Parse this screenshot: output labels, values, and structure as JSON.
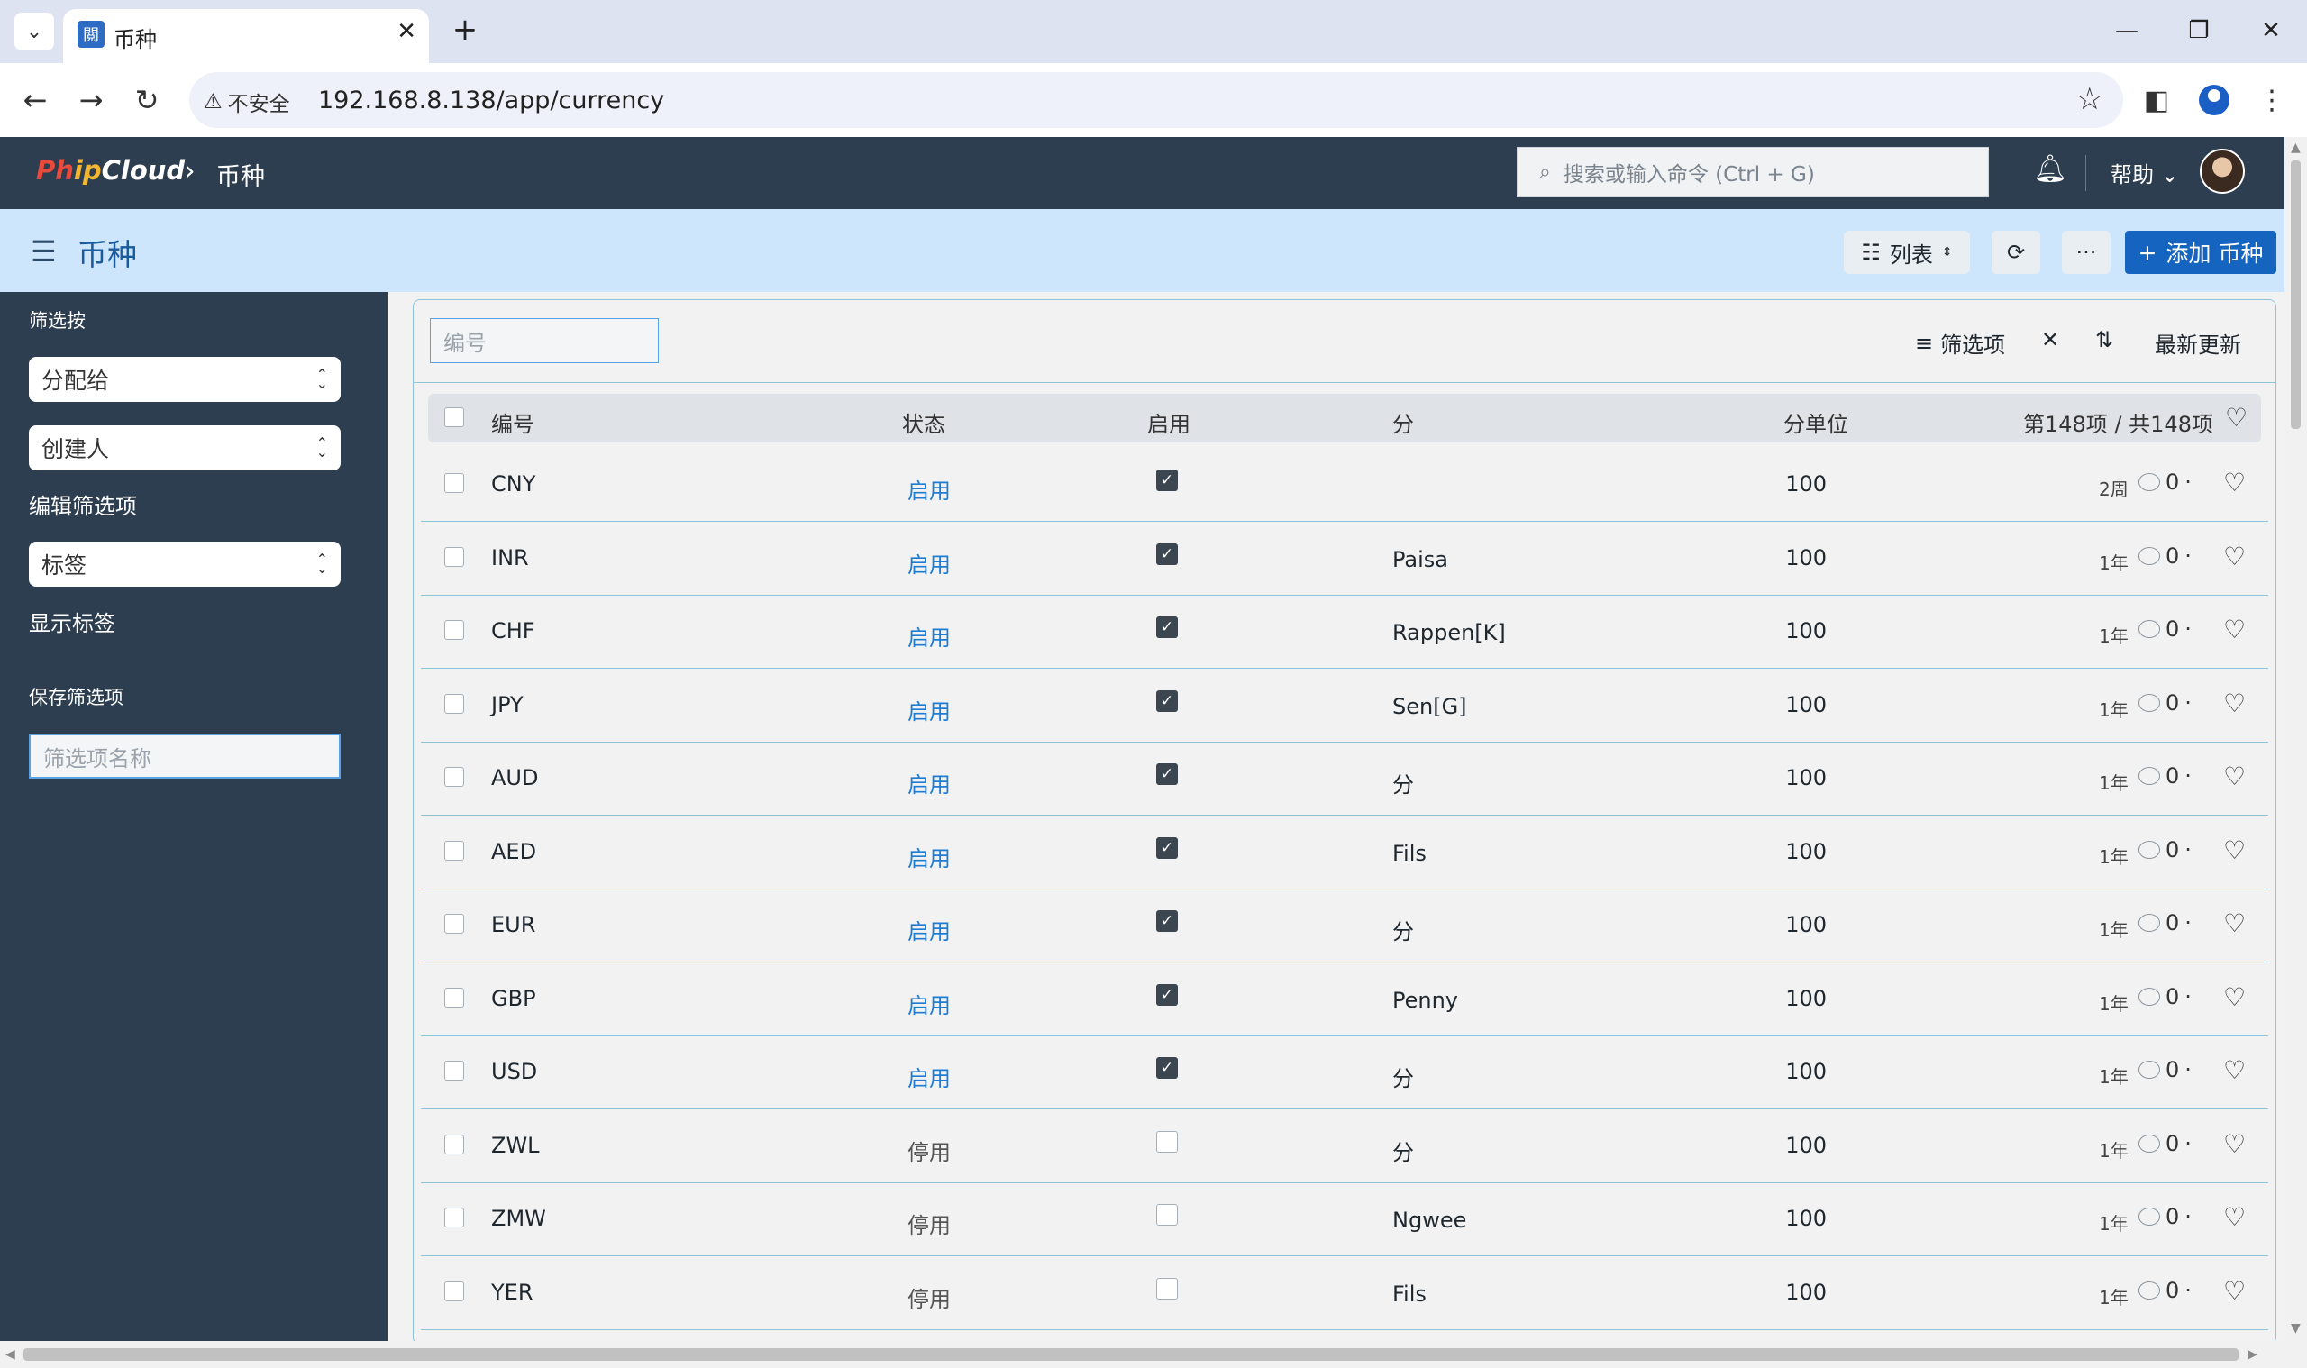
{
  "browser": {
    "tab_title": "币种",
    "favicon": "閲",
    "security_label": "不安全",
    "url": "192.168.8.138/app/currency"
  },
  "navbar": {
    "brand_part1": "Ph",
    "brand_part2": "ip",
    "brand_part3": "Cloud",
    "breadcrumb": "币种",
    "search_placeholder": "搜索或输入命令 (Ctrl + G)",
    "help_label": "帮助"
  },
  "page_head": {
    "title": "币种",
    "view_label": "列表",
    "more_label": "···",
    "add_label": "添加 币种"
  },
  "sidebar": {
    "filter_by": "筛选按",
    "assigned_to": "分配给",
    "created_by": "创建人",
    "edit_filters": "编辑筛选项",
    "tags": "标签",
    "show_tags": "显示标签",
    "save_filters": "保存筛选项",
    "filter_name_placeholder": "筛选项名称"
  },
  "list": {
    "id_filter_placeholder": "编号",
    "filter_label": "筛选项",
    "sort_label": "最新更新",
    "columns": {
      "id": "编号",
      "status": "状态",
      "enabled": "启用",
      "fraction": "分",
      "fraction_units": "分单位"
    },
    "count_label": "第148项 / 共148项",
    "rows": [
      {
        "id": "CNY",
        "status": "启用",
        "enabled": true,
        "fraction": "",
        "units": "100",
        "time": "2周",
        "comments": "0"
      },
      {
        "id": "INR",
        "status": "启用",
        "enabled": true,
        "fraction": "Paisa",
        "units": "100",
        "time": "1年",
        "comments": "0"
      },
      {
        "id": "CHF",
        "status": "启用",
        "enabled": true,
        "fraction": "Rappen[K]",
        "units": "100",
        "time": "1年",
        "comments": "0"
      },
      {
        "id": "JPY",
        "status": "启用",
        "enabled": true,
        "fraction": "Sen[G]",
        "units": "100",
        "time": "1年",
        "comments": "0"
      },
      {
        "id": "AUD",
        "status": "启用",
        "enabled": true,
        "fraction": "分",
        "units": "100",
        "time": "1年",
        "comments": "0"
      },
      {
        "id": "AED",
        "status": "启用",
        "enabled": true,
        "fraction": "Fils",
        "units": "100",
        "time": "1年",
        "comments": "0"
      },
      {
        "id": "EUR",
        "status": "启用",
        "enabled": true,
        "fraction": "分",
        "units": "100",
        "time": "1年",
        "comments": "0"
      },
      {
        "id": "GBP",
        "status": "启用",
        "enabled": true,
        "fraction": "Penny",
        "units": "100",
        "time": "1年",
        "comments": "0"
      },
      {
        "id": "USD",
        "status": "启用",
        "enabled": true,
        "fraction": "分",
        "units": "100",
        "time": "1年",
        "comments": "0"
      },
      {
        "id": "ZWL",
        "status": "停用",
        "enabled": false,
        "fraction": "分",
        "units": "100",
        "time": "1年",
        "comments": "0"
      },
      {
        "id": "ZMW",
        "status": "停用",
        "enabled": false,
        "fraction": "Ngwee",
        "units": "100",
        "time": "1年",
        "comments": "0"
      },
      {
        "id": "YER",
        "status": "停用",
        "enabled": false,
        "fraction": "Fils",
        "units": "100",
        "time": "1年",
        "comments": "0"
      }
    ]
  },
  "colors": {
    "navbar_bg": "#2c3e50",
    "pagehead_bg": "#cde6fb",
    "primary": "#1565c0",
    "status_enabled": "#1e7dd2"
  }
}
